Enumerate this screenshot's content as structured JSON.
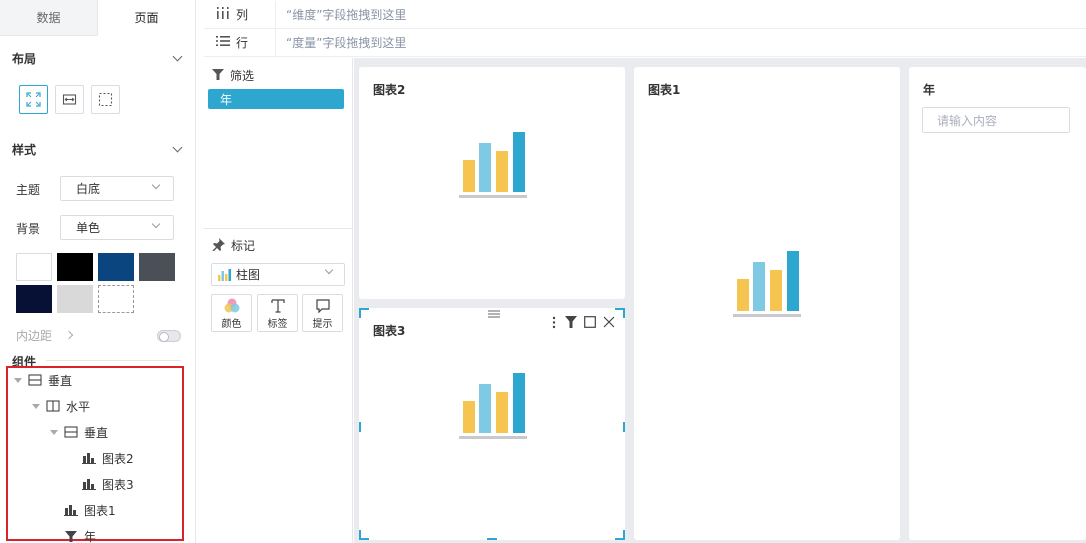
{
  "tabs": {
    "data": "数据",
    "page": "页面"
  },
  "layout": {
    "title": "布局"
  },
  "style": {
    "title": "样式",
    "theme_label": "主题",
    "theme_value": "白底",
    "bg_label": "背景",
    "bg_value": "单色",
    "swatches": [
      "#ffffff",
      "#000000",
      "#0b4580",
      "#4b4f57",
      "#071136",
      "#d9d9d9",
      "#ffffff"
    ],
    "padding_label": "内边距"
  },
  "components": {
    "title": "组件",
    "tree": [
      {
        "label": "垂直",
        "icon": "vertical-layout-icon"
      },
      {
        "label": "水平",
        "icon": "horizontal-layout-icon"
      },
      {
        "label": "垂直",
        "icon": "vertical-layout-icon"
      },
      {
        "label": "图表2",
        "icon": "bar-chart-icon"
      },
      {
        "label": "图表3",
        "icon": "bar-chart-icon"
      },
      {
        "label": "图表1",
        "icon": "bar-chart-icon"
      },
      {
        "label": "年",
        "icon": "filter-icon"
      }
    ]
  },
  "shelf": {
    "columns_label": "列",
    "columns_hint": "“维度”字段拖拽到这里",
    "rows_label": "行",
    "rows_hint": "“度量”字段拖拽到这里"
  },
  "filter": {
    "title": "筛选",
    "chip": "年"
  },
  "marks": {
    "title": "标记",
    "chart_type": "柱图",
    "buttons": [
      "颜色",
      "标签",
      "提示"
    ]
  },
  "cards": {
    "chart2_title": "图表2",
    "chart1_title": "图表1",
    "chart3_title": "图表3",
    "year_title": "年",
    "year_placeholder": "请输入内容"
  },
  "colors": {
    "accent": "#2ea7d0",
    "bar_yellow": "#f5c451",
    "bar_lightblue": "#7ec9e4",
    "bar_blue": "#2ea7d0",
    "base": "#c7c9cc",
    "highlight_box": "#d9232a"
  }
}
